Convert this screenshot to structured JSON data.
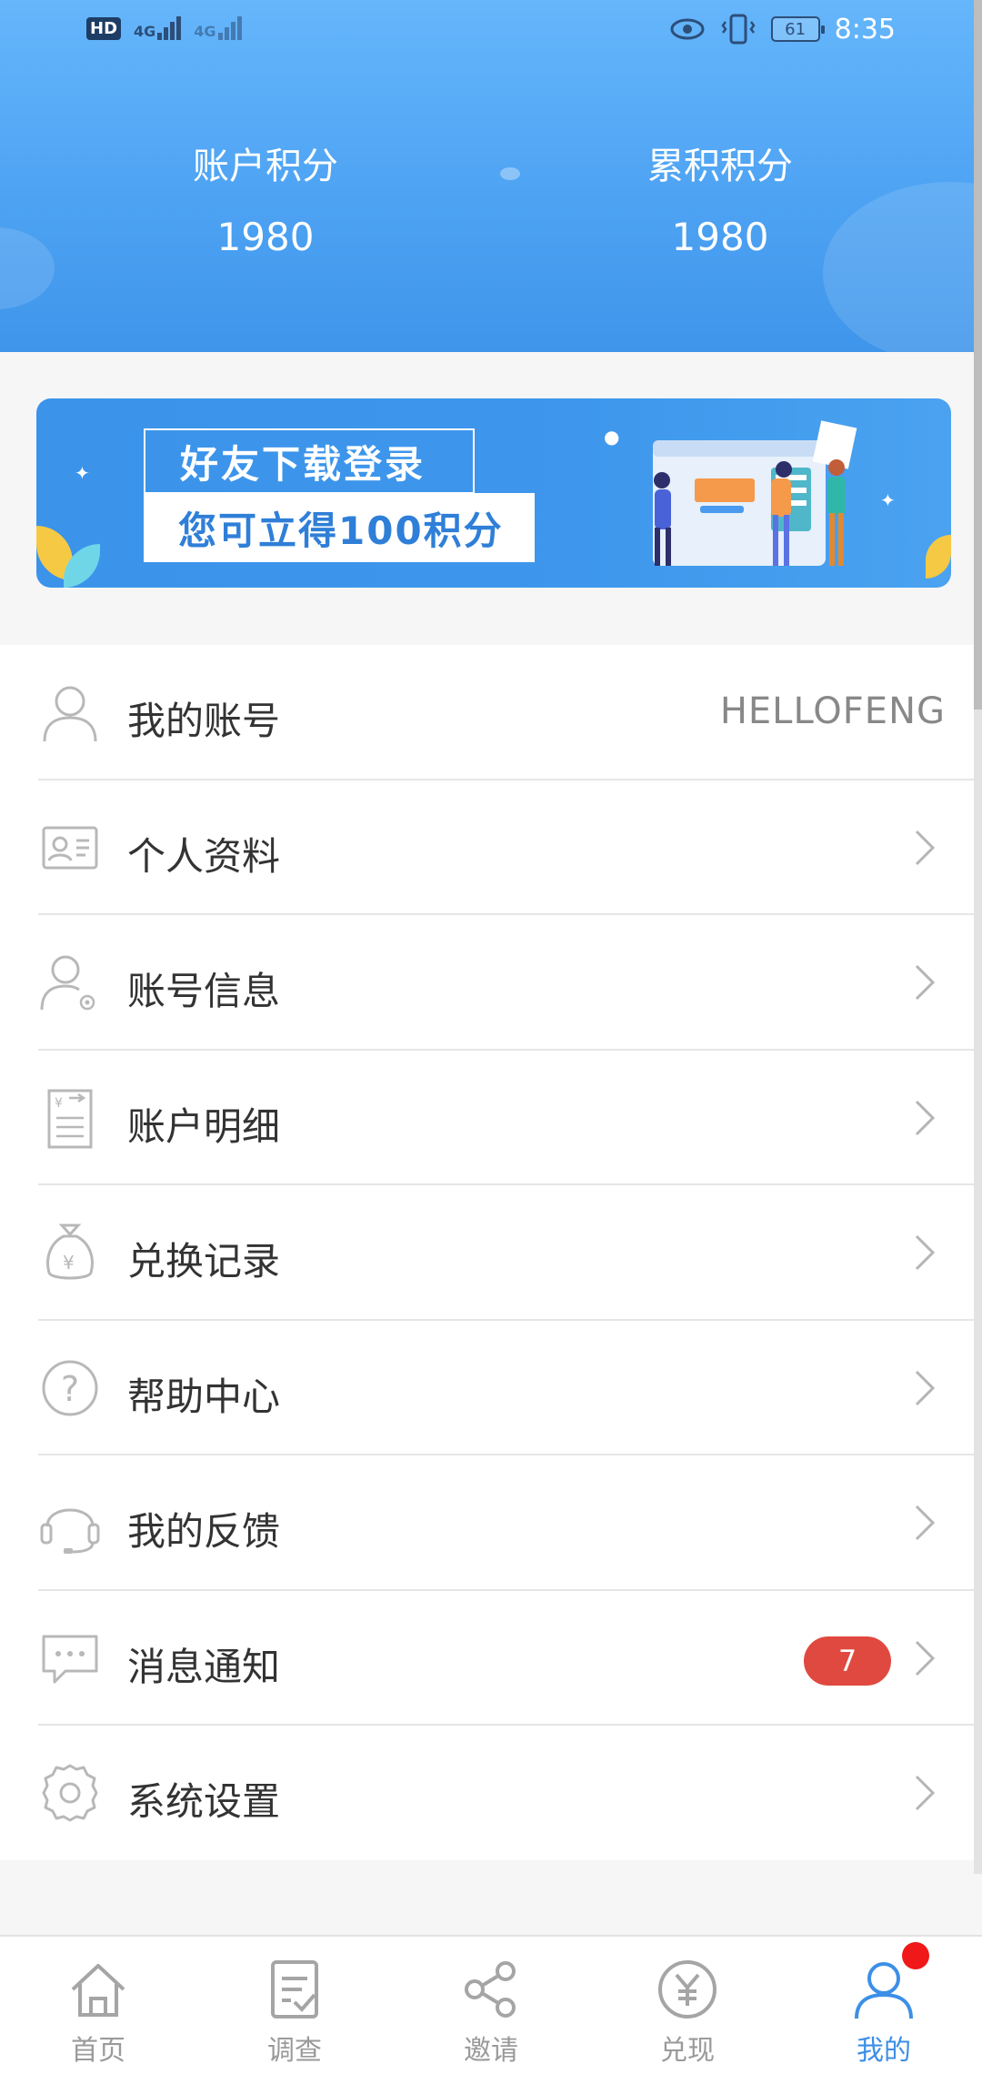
{
  "status_bar": {
    "hd": "HD",
    "sim1": "1",
    "net1": "4G",
    "net2": "4G",
    "battery": "61",
    "time": "8:35"
  },
  "points": {
    "account_label": "账户积分",
    "account_value": "1980",
    "total_label": "累积积分",
    "total_value": "1980"
  },
  "banner": {
    "line1": "好友下载登录",
    "line2": "您可立得100积分"
  },
  "menu": {
    "account": {
      "label": "我的账号",
      "value": "HELLOFENG",
      "icon": "user-icon"
    },
    "profile": {
      "label": "个人资料",
      "icon": "id-card-icon"
    },
    "account_info": {
      "label": "账号信息",
      "icon": "user-settings-icon"
    },
    "account_detail": {
      "label": "账户明细",
      "icon": "bill-icon"
    },
    "exchange_records": {
      "label": "兑换记录",
      "icon": "money-bag-icon"
    },
    "help_center": {
      "label": "帮助中心",
      "icon": "question-icon"
    },
    "feedback": {
      "label": "我的反馈",
      "icon": "headset-icon"
    },
    "notifications": {
      "label": "消息通知",
      "badge": "7",
      "icon": "chat-icon"
    },
    "settings": {
      "label": "系统设置",
      "icon": "gear-icon"
    }
  },
  "tabs": {
    "home": "首页",
    "survey": "调查",
    "invite": "邀请",
    "redeem": "兑现",
    "mine": "我的"
  },
  "colors": {
    "header_blue": "#4ea3f3",
    "active_tab": "#3c8fe6",
    "badge_red": "#e0493f"
  }
}
